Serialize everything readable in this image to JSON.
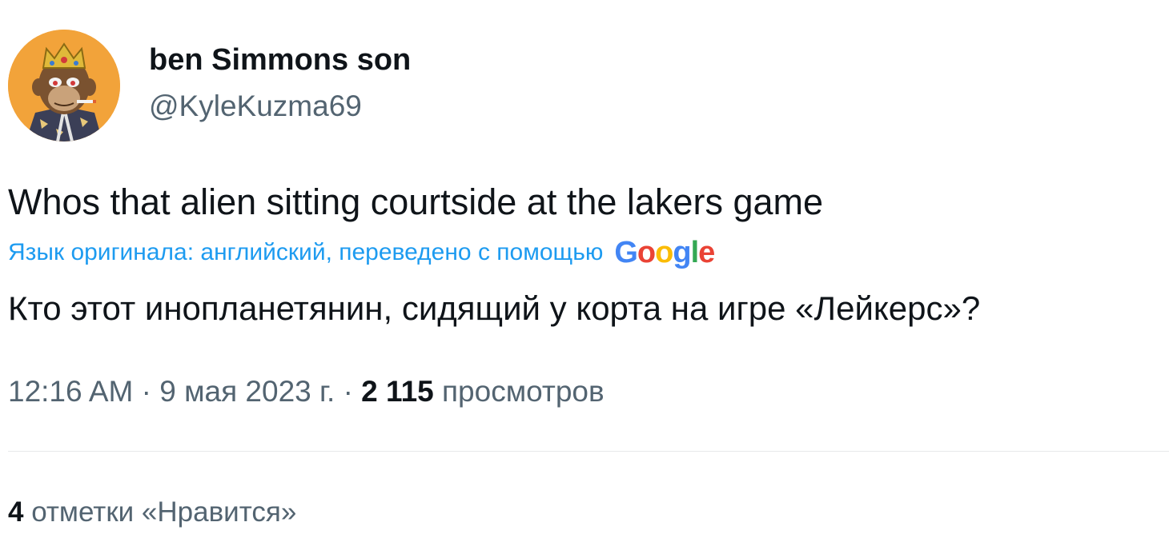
{
  "author": {
    "display_name": "ben Simmons son",
    "handle": "@KyleKuzma69",
    "avatar_icon": "ape-avatar"
  },
  "tweet": {
    "text": "Whos that alien sitting courtside at the lakers game",
    "translation_note": "Язык оригинала: английский, переведено с помощью",
    "translation_provider": "Google",
    "translated_text": "Кто этот инопланетянин, сидящий у корта на игре «Лейкерс»?"
  },
  "meta": {
    "time": "12:16 AM",
    "separator": "·",
    "date": "9 мая 2023 г.",
    "views_count": "2 115",
    "views_label": "просмотров"
  },
  "stats": {
    "likes_count": "4",
    "likes_label": "отметки «Нравится»"
  },
  "colors": {
    "accent": "#1d9bf0",
    "secondary_text": "#536471",
    "primary_text": "#0f1419",
    "divider": "#e7e9ea"
  }
}
